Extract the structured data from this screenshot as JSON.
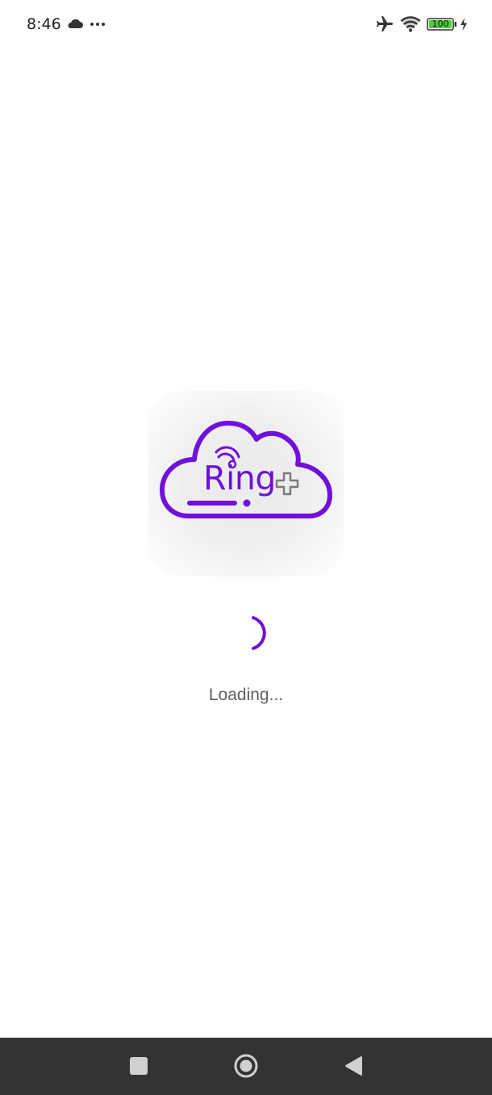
{
  "status_bar": {
    "time": "8:46",
    "battery_level": "100",
    "icons": [
      "cloud-icon",
      "more-dots-icon",
      "airplane-mode-icon",
      "wifi-icon",
      "battery-icon",
      "charging-bolt-icon"
    ]
  },
  "splash": {
    "logo_text": "Ring",
    "logo_icon": "cloud-logo-icon",
    "loading_text": "Loading..."
  },
  "nav_bar": {
    "icons": [
      "recents-square-icon",
      "home-circle-icon",
      "back-triangle-icon"
    ]
  },
  "colors": {
    "brand": "#7010d8",
    "nav_background": "#333333",
    "battery_fill": "#4cd137",
    "text_muted": "#5f5f5f"
  }
}
